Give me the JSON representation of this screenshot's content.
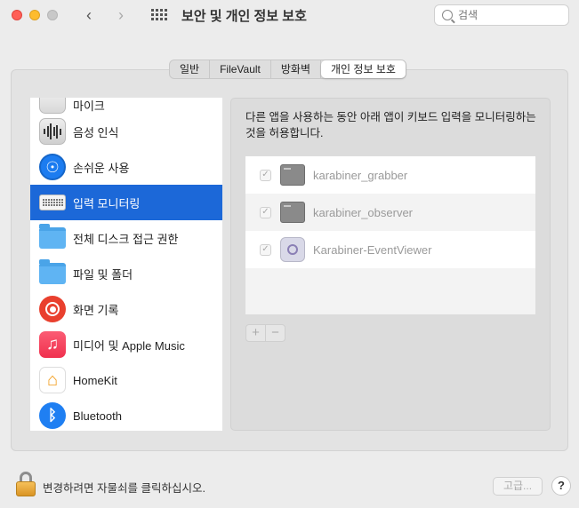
{
  "window": {
    "title": "보안 및 개인 정보 보호",
    "search_placeholder": "검색"
  },
  "tabs": [
    {
      "label": "일반",
      "active": false
    },
    {
      "label": "FileVault",
      "active": false
    },
    {
      "label": "방화벽",
      "active": false
    },
    {
      "label": "개인 정보 보호",
      "active": true
    }
  ],
  "sidebar": {
    "items": [
      {
        "label": "마이크",
        "icon": "microphone-icon"
      },
      {
        "label": "음성 인식",
        "icon": "speech-recognition-icon"
      },
      {
        "label": "손쉬운 사용",
        "icon": "accessibility-icon"
      },
      {
        "label": "입력 모니터링",
        "icon": "keyboard-icon",
        "selected": true
      },
      {
        "label": "전체 디스크 접근 권한",
        "icon": "folder-icon"
      },
      {
        "label": "파일 및 폴더",
        "icon": "folder-icon"
      },
      {
        "label": "화면 기록",
        "icon": "screen-record-icon"
      },
      {
        "label": "미디어 및 Apple Music",
        "icon": "music-icon"
      },
      {
        "label": "HomeKit",
        "icon": "homekit-icon"
      },
      {
        "label": "Bluetooth",
        "icon": "bluetooth-icon"
      }
    ]
  },
  "main": {
    "description": "다른 앱을 사용하는 동안 아래 앱이 키보드 입력을 모니터링하는 것을 허용합니다.",
    "apps": [
      {
        "name": "karabiner_grabber",
        "checked": true,
        "icon": "terminal-icon"
      },
      {
        "name": "karabiner_observer",
        "checked": true,
        "icon": "terminal-icon"
      },
      {
        "name": "Karabiner-EventViewer",
        "checked": true,
        "icon": "event-viewer-icon"
      }
    ],
    "add_label": "+",
    "remove_label": "−"
  },
  "footer": {
    "lock_text": "변경하려면 자물쇠를 클릭하십시오.",
    "advanced_label": "고급...",
    "help_label": "?"
  }
}
